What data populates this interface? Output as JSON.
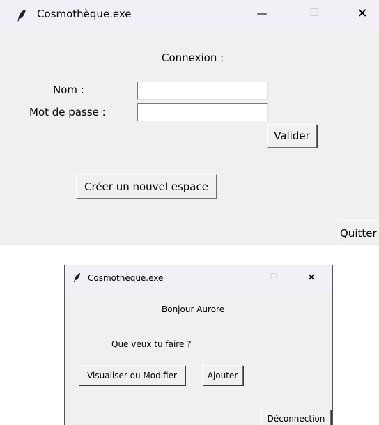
{
  "login_window": {
    "title": "Cosmothèque.exe",
    "controls": {
      "minimize": "—",
      "maximize": "☐",
      "close": "✕"
    },
    "heading": "Connexion :",
    "name_label": "Nom :",
    "name_value": "",
    "password_label": "Mot de passe :",
    "password_value": "",
    "submit_label": "Valider",
    "create_label": "Créer un nouvel espace",
    "quit_label": "Quitter"
  },
  "menu_window": {
    "title": "Cosmothèque.exe",
    "controls": {
      "minimize": "—",
      "maximize": "☐",
      "close": "✕"
    },
    "greeting": "Bonjour Aurore",
    "question": "Que veux tu faire ?",
    "view_edit_label": "Visualiser ou Modifier",
    "add_label": "Ajouter",
    "logout_label": "Déconnection"
  },
  "colors": {
    "titlebar": "#f3eff7",
    "window": "#f0f0f0",
    "entry": "#ffffff"
  }
}
